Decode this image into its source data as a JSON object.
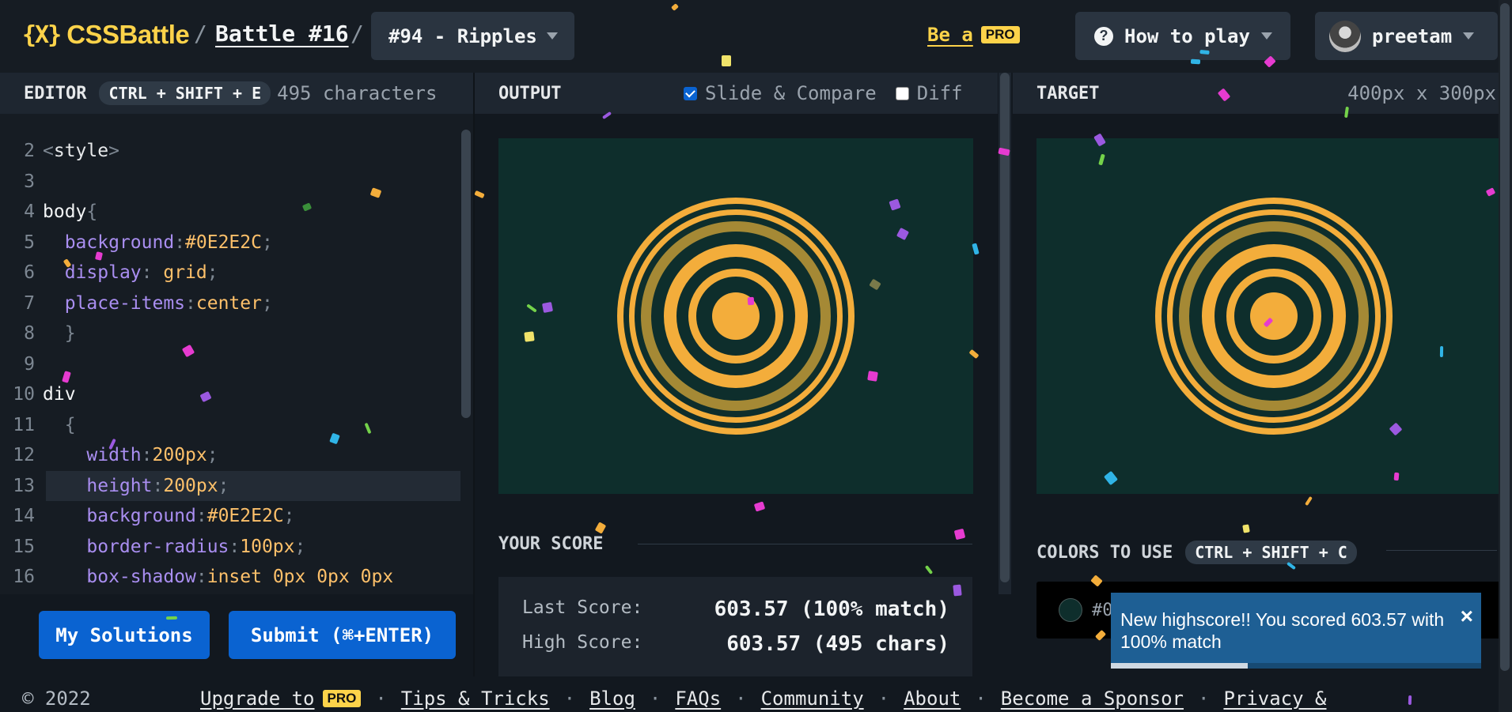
{
  "header": {
    "logo_mark": "{X}",
    "logo_text": "CSSBattle",
    "battle_link": "Battle #16",
    "level_select": "#94 - Ripples",
    "be_a": "Be a",
    "pro_badge": "PRO",
    "how_to_play": "How to play",
    "username": "preetam"
  },
  "editor": {
    "title": "EDITOR",
    "shortcut": "CTRL + SHIFT + E",
    "char_count": "495 characters",
    "lines": [
      {
        "num": "2",
        "html": "<span class='t-punct'>&lt;</span><span class='t-tag'>style</span><span class='t-punct'>&gt;</span>"
      },
      {
        "num": "3",
        "html": ""
      },
      {
        "num": "4",
        "html": "<span class='t-sel'>body</span><span class='t-punct'>{</span>"
      },
      {
        "num": "5",
        "html": "  <span class='t-prop'>background</span><span class='t-punct'>:</span><span class='t-hex'>#0E2E2C</span><span class='t-punct'>;</span>"
      },
      {
        "num": "6",
        "html": "  <span class='t-prop'>display</span><span class='t-punct'>:</span> <span class='t-val'>grid</span><span class='t-punct'>;</span>"
      },
      {
        "num": "7",
        "html": "  <span class='t-prop'>place-items</span><span class='t-punct'>:</span><span class='t-val'>center</span><span class='t-punct'>;</span>"
      },
      {
        "num": "8",
        "html": "  <span class='t-punct'>}</span>"
      },
      {
        "num": "9",
        "html": ""
      },
      {
        "num": "10",
        "html": "<span class='t-sel'>div</span>"
      },
      {
        "num": "11",
        "html": "  <span class='t-punct'>{</span>"
      },
      {
        "num": "12",
        "html": "    <span class='t-prop'>width</span><span class='t-punct'>:</span><span class='t-val'>200px</span><span class='t-punct'>;</span>"
      },
      {
        "num": "13",
        "html": "    <span class='t-prop'>height</span><span class='t-punct'>:</span><span class='t-val'>200px</span><span class='t-punct'>;</span>",
        "active": true
      },
      {
        "num": "14",
        "html": "    <span class='t-prop'>background</span><span class='t-punct'>:</span><span class='t-hex'>#0E2E2C</span><span class='t-punct'>;</span>"
      },
      {
        "num": "15",
        "html": "    <span class='t-prop'>border-radius</span><span class='t-punct'>:</span><span class='t-val'>100px</span><span class='t-punct'>;</span>"
      },
      {
        "num": "16",
        "html": "    <span class='t-prop'>box-shadow</span><span class='t-punct'>:</span><span class='t-val'>inset 0px 0px 0px</span>"
      }
    ],
    "my_solutions": "My Solutions",
    "submit": "Submit (⌘+ENTER)"
  },
  "output": {
    "title": "OUTPUT",
    "slide_compare": "Slide & Compare",
    "slide_compare_checked": true,
    "diff": "Diff",
    "diff_checked": false
  },
  "score": {
    "title": "YOUR SCORE",
    "last_label": "Last Score:",
    "last_value": "603.57 (100% match)",
    "high_label": "High Score:",
    "high_value": "603.57 (495 chars)"
  },
  "target": {
    "title": "TARGET",
    "dimensions": "400px x 300px",
    "colors_title": "COLORS TO USE",
    "colors_shortcut": "CTRL + SHIFT + C",
    "color_code": "#0E2E2C"
  },
  "colors": {
    "bg": "#0E2E2C",
    "ring_bright": "#F3AD3B",
    "ring_dim": "#A58935",
    "accent_blue": "#0A63D1",
    "logo_yellow": "#FDD34A"
  },
  "toast": {
    "message": "New highscore!! You scored 603.57 with 100% match",
    "close": "×",
    "progress": 0.37
  },
  "footer": {
    "copyright": "© 2022",
    "upgrade": "Upgrade to",
    "pro": "PRO",
    "tips": "Tips & Tricks",
    "blog": "Blog",
    "faqs": "FAQs",
    "community": "Community",
    "about": "About",
    "sponsor": "Become a Sponsor",
    "privacy": "Privacy &"
  }
}
